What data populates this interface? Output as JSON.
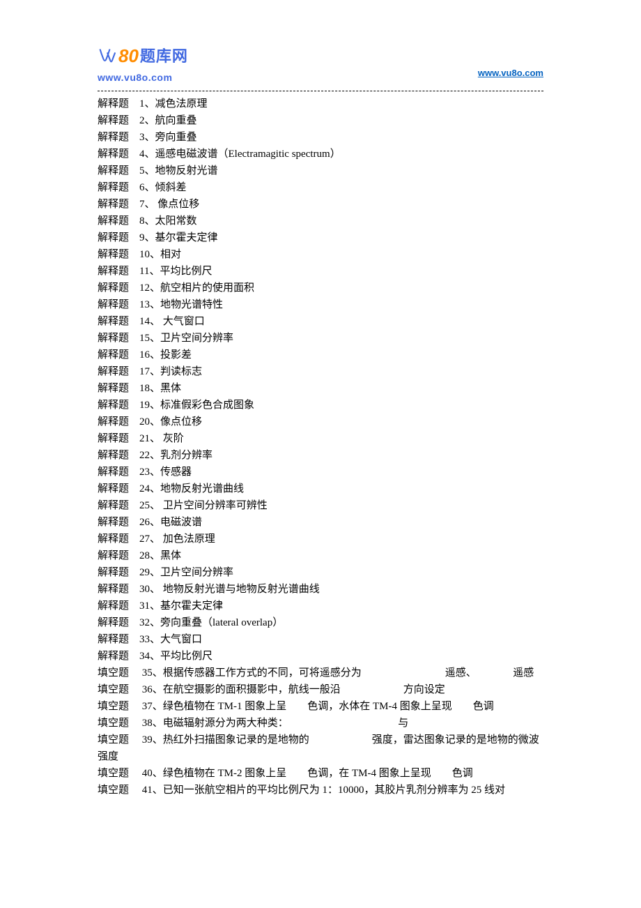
{
  "header": {
    "logo_80": "80",
    "logo_cn": "题库网",
    "logo_url": "www.vu8o.com",
    "link": "www.vu8o.com"
  },
  "type_labels": {
    "explain": "解释题",
    "fill": "填空题"
  },
  "explain_items": [
    {
      "num": "1",
      "text": "减色法原理"
    },
    {
      "num": "2",
      "text": "航向重叠"
    },
    {
      "num": "3",
      "text": "旁向重叠"
    },
    {
      "num": "4",
      "text": "遥感电磁波谱（Electramagitic spectrum）"
    },
    {
      "num": "5",
      "text": "地物反射光谱"
    },
    {
      "num": "6",
      "text": "倾斜差"
    },
    {
      "num": "7",
      "text": " 像点位移"
    },
    {
      "num": "8",
      "text": "太阳常数"
    },
    {
      "num": "9",
      "text": "基尔霍夫定律"
    },
    {
      "num": "10",
      "text": "相对"
    },
    {
      "num": "11",
      "text": "平均比例尺"
    },
    {
      "num": "12",
      "text": "航空相片的使用面积"
    },
    {
      "num": "13",
      "text": "地物光谱特性"
    },
    {
      "num": "14",
      "text": " 大气窗口"
    },
    {
      "num": "15",
      "text": "卫片空间分辨率"
    },
    {
      "num": "16",
      "text": "投影差"
    },
    {
      "num": "17",
      "text": "判读标志"
    },
    {
      "num": "18",
      "text": "黑体"
    },
    {
      "num": "19",
      "text": "标准假彩色合成图象"
    },
    {
      "num": "20",
      "text": "像点位移"
    },
    {
      "num": "21",
      "text": " 灰阶"
    },
    {
      "num": "22",
      "text": "乳剂分辨率"
    },
    {
      "num": "23",
      "text": "传感器"
    },
    {
      "num": "24",
      "text": "地物反射光谱曲线"
    },
    {
      "num": "25",
      "text": " 卫片空间分辨率可辨性"
    },
    {
      "num": "26",
      "text": "电磁波谱"
    },
    {
      "num": "27",
      "text": " 加色法原理"
    },
    {
      "num": "28",
      "text": "黑体"
    },
    {
      "num": "29",
      "text": "卫片空间分辨率"
    },
    {
      "num": "30",
      "text": " 地物反射光谱与地物反射光谱曲线"
    },
    {
      "num": "31",
      "text": "基尔霍夫定律"
    },
    {
      "num": "32",
      "text": "旁向重叠（lateral overlap）"
    },
    {
      "num": "33",
      "text": "大气窗口"
    },
    {
      "num": "34",
      "text": "平均比例尺"
    }
  ],
  "fill_items": [
    {
      "num": "35",
      "text": "根据传感器工作方式的不同，可将遥感分为　　　　　　　　遥感、　　　　遥感",
      "wrap": true
    },
    {
      "num": "36",
      "text": "在航空摄影的面积摄影中，航线一般沿　　　　　　方向设定"
    },
    {
      "num": "37",
      "text": "绿色植物在 TM-1 图象上呈　　色调，水体在 TM-4 图象上呈现　　色调"
    },
    {
      "num": "38",
      "text": "电磁辐射源分为两大种类：　　　　　　　　　　　与"
    },
    {
      "num": "39",
      "text": "热红外扫描图象记录的是地物的　　　　　　强度，雷达图象记录的是地物的微波　　　　　强度",
      "wrap": true
    },
    {
      "num": "40",
      "text": "绿色植物在 TM-2 图象上呈　　色调，在 TM-4 图象上呈现　　色调"
    },
    {
      "num": "41",
      "text": "已知一张航空相片的平均比例尺为 1：10000，其胶片乳剂分辨率为 25 线对"
    }
  ]
}
